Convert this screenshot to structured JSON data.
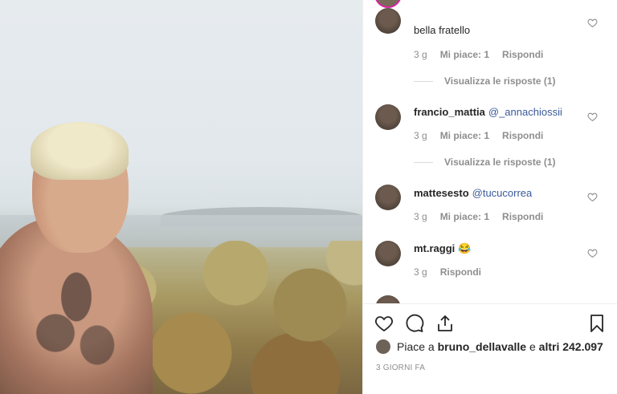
{
  "comments": [
    {
      "user": "",
      "text": "bella fratello",
      "time": "3 g",
      "likes": "Mi piace: 1",
      "reply": "Rispondi",
      "view_replies": "Visualizza le risposte (1)"
    },
    {
      "user": "francio_mattia",
      "mention": "@_annachiossii",
      "text": "",
      "time": "3 g",
      "likes": "Mi piace: 1",
      "reply": "Rispondi",
      "view_replies": "Visualizza le risposte (1)"
    },
    {
      "user": "mattesesto",
      "mention": "@tucucorrea",
      "text": "",
      "time": "3 g",
      "likes": "Mi piace: 1",
      "reply": "Rispondi"
    },
    {
      "user": "mt.raggi",
      "text": "😂",
      "time": "3 g",
      "reply": "Rispondi"
    }
  ],
  "likes_line": {
    "prefix": "Piace a",
    "user": "bruno_dellavalle",
    "middle": "e",
    "others": "altri 242.097"
  },
  "post_date": "3 GIORNI FA",
  "icons": [
    "heart-icon",
    "comment-icon",
    "share-icon",
    "bookmark-icon"
  ]
}
